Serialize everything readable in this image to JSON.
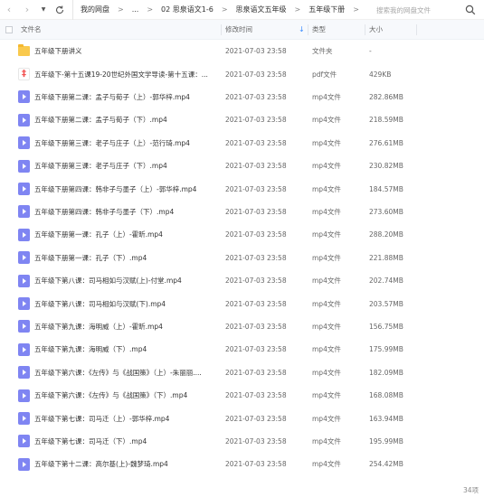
{
  "nav": {
    "back_icon": "chevron-left-icon",
    "forward_icon": "chevron-right-icon",
    "dropdown_icon": "caret-down-icon",
    "refresh_icon": "refresh-icon"
  },
  "breadcrumb": {
    "items": [
      "我的网盘",
      "...",
      "02 思泉语文1-6",
      "思泉语文五年级",
      "五年级下册"
    ],
    "separator": ">"
  },
  "search": {
    "placeholder": "搜索我的网盘文件"
  },
  "table": {
    "columns": {
      "name": "文件名",
      "date": "修改时间",
      "type": "类型",
      "size": "大小"
    },
    "sort_indicator": "↓",
    "rows": [
      {
        "icon": "folder",
        "name": "五年级下册讲义",
        "date": "2021-07-03 23:58",
        "type": "文件夹",
        "size": "-"
      },
      {
        "icon": "pdf",
        "name": "五年级下-第十五课19-20世纪外国文学导读-第十五课：...",
        "date": "2021-07-03 23:58",
        "type": "pdf文件",
        "size": "429KB"
      },
      {
        "icon": "video",
        "name": "五年级下册第二课：孟子与荀子（上）-郭华梓.mp4",
        "date": "2021-07-03 23:58",
        "type": "mp4文件",
        "size": "282.86MB"
      },
      {
        "icon": "video",
        "name": "五年级下册第二课：孟子与荀子（下）.mp4",
        "date": "2021-07-03 23:58",
        "type": "mp4文件",
        "size": "218.59MB"
      },
      {
        "icon": "video",
        "name": "五年级下册第三课：老子与庄子（上）-范行琦.mp4",
        "date": "2021-07-03 23:58",
        "type": "mp4文件",
        "size": "276.61MB"
      },
      {
        "icon": "video",
        "name": "五年级下册第三课：老子与庄子（下）.mp4",
        "date": "2021-07-03 23:58",
        "type": "mp4文件",
        "size": "230.82MB"
      },
      {
        "icon": "video",
        "name": "五年级下册第四课：韩非子与墨子（上）-郭华梓.mp4",
        "date": "2021-07-03 23:58",
        "type": "mp4文件",
        "size": "184.57MB"
      },
      {
        "icon": "video",
        "name": "五年级下册第四课：韩非子与墨子（下）.mp4",
        "date": "2021-07-03 23:58",
        "type": "mp4文件",
        "size": "273.60MB"
      },
      {
        "icon": "video",
        "name": "五年级下册第一课：孔子（上）-霍昕.mp4",
        "date": "2021-07-03 23:58",
        "type": "mp4文件",
        "size": "288.20MB"
      },
      {
        "icon": "video",
        "name": "五年级下册第一课：孔子（下）.mp4",
        "date": "2021-07-03 23:58",
        "type": "mp4文件",
        "size": "221.88MB"
      },
      {
        "icon": "video",
        "name": "五年级下第八课：司马相如与汉赋(上)-付堂.mp4",
        "date": "2021-07-03 23:58",
        "type": "mp4文件",
        "size": "202.74MB"
      },
      {
        "icon": "video",
        "name": "五年级下第八课：司马相如与汉赋(下).mp4",
        "date": "2021-07-03 23:58",
        "type": "mp4文件",
        "size": "203.57MB"
      },
      {
        "icon": "video",
        "name": "五年级下第九课：海明威（上）-霍昕.mp4",
        "date": "2021-07-03 23:58",
        "type": "mp4文件",
        "size": "156.75MB"
      },
      {
        "icon": "video",
        "name": "五年级下第九课：海明威（下）.mp4",
        "date": "2021-07-03 23:58",
        "type": "mp4文件",
        "size": "175.99MB"
      },
      {
        "icon": "video",
        "name": "五年级下第六课：《左传》与《战国策》（上）-朱丽丽....",
        "date": "2021-07-03 23:58",
        "type": "mp4文件",
        "size": "182.09MB"
      },
      {
        "icon": "video",
        "name": "五年级下第六课：《左传》与《战国策》（下）.mp4",
        "date": "2021-07-03 23:58",
        "type": "mp4文件",
        "size": "168.08MB"
      },
      {
        "icon": "video",
        "name": "五年级下第七课：司马迁（上）-郭华梓.mp4",
        "date": "2021-07-03 23:58",
        "type": "mp4文件",
        "size": "163.94MB"
      },
      {
        "icon": "video",
        "name": "五年级下第七课：司马迁（下）.mp4",
        "date": "2021-07-03 23:58",
        "type": "mp4文件",
        "size": "195.99MB"
      },
      {
        "icon": "video",
        "name": "五年级下第十二课：高尔基(上)-魏梦琦.mp4",
        "date": "2021-07-03 23:58",
        "type": "mp4文件",
        "size": "254.42MB"
      }
    ]
  },
  "footer": {
    "count": "34项"
  },
  "colors": {
    "accent": "#3b8cff",
    "video_icon": "#7f85f2",
    "folder_icon": "#f9c94d",
    "pdf_icon": "#f25050"
  }
}
